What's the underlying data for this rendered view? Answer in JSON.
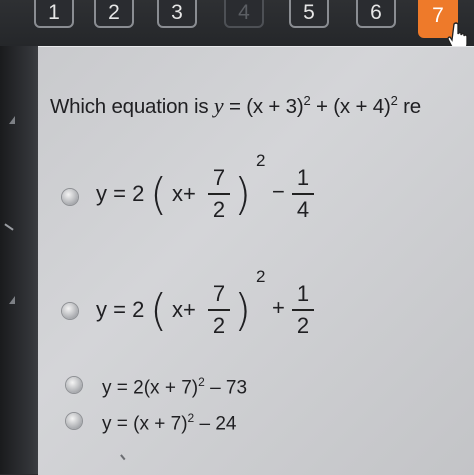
{
  "nav": {
    "questions": [
      {
        "label": "1",
        "state": "normal"
      },
      {
        "label": "2",
        "state": "normal"
      },
      {
        "label": "3",
        "state": "normal"
      },
      {
        "label": "4",
        "state": "disabled"
      },
      {
        "label": "5",
        "state": "normal"
      },
      {
        "label": "6",
        "state": "normal"
      },
      {
        "label": "7",
        "state": "active"
      }
    ],
    "accent_color": "#ee7a2a"
  },
  "question": {
    "text_prefix": "Which equation is ",
    "y": "y",
    "eq_mid": " = (x + 3)",
    "exp1": "2",
    "eq_plus": " + (x + 4)",
    "exp2": "2",
    "text_suffix": " re"
  },
  "options": [
    {
      "lead": "y = 2",
      "inner": "x+",
      "num": "7",
      "den": "2",
      "exp": "2",
      "sign": "−",
      "tail_num": "1",
      "tail_den": "4"
    },
    {
      "lead": "y = 2",
      "inner": "x+",
      "num": "7",
      "den": "2",
      "exp": "2",
      "sign": "+",
      "tail_num": "1",
      "tail_den": "2"
    },
    {
      "text": "y = 2(x + 7)",
      "exp": "2",
      "tail": " – 73"
    },
    {
      "text": "y = (x + 7)",
      "exp": "2",
      "tail": " – 24"
    }
  ]
}
